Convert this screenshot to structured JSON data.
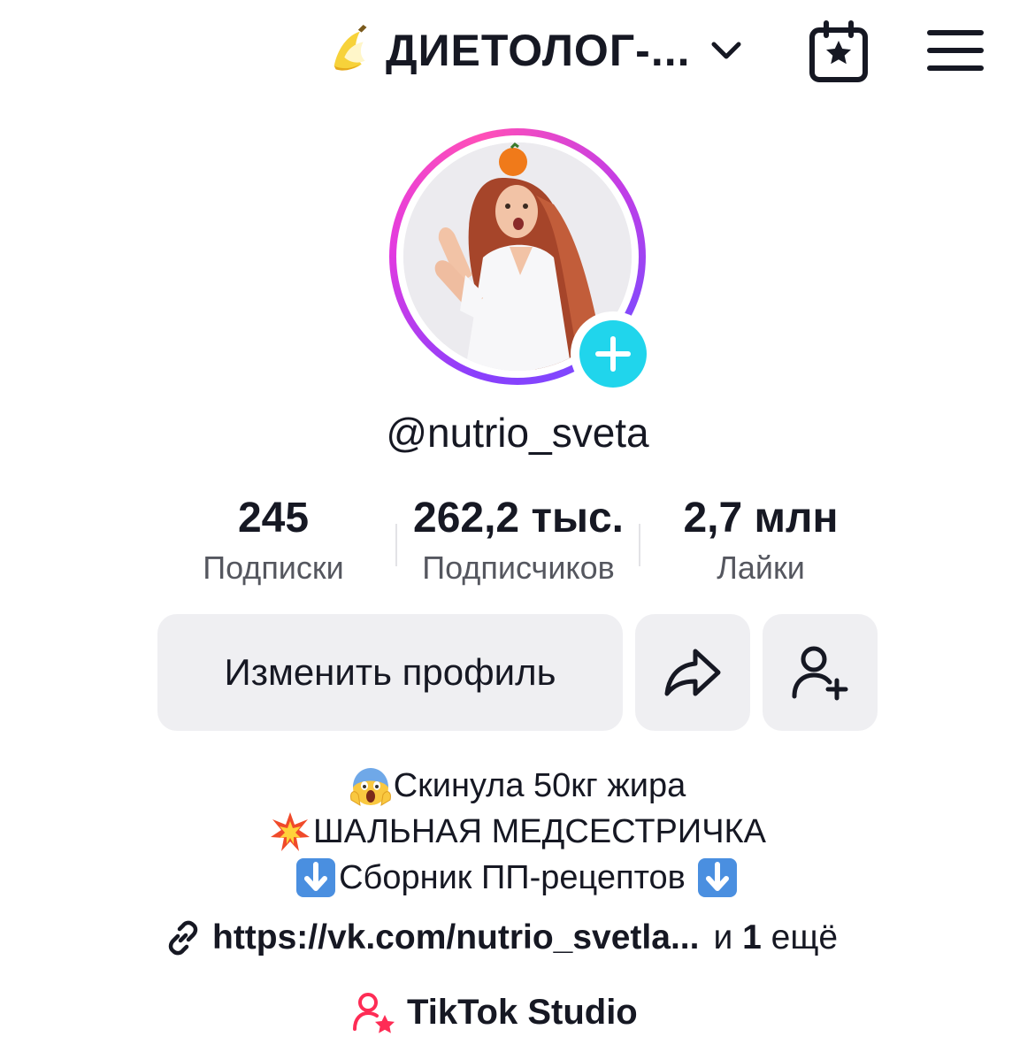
{
  "header": {
    "account_name": "ДИЕТОЛОГ-...",
    "account_emoji": "banana-emoji",
    "dropdown_icon": "chevron-down-icon",
    "calendar_icon": "calendar-star-icon",
    "menu_icon": "hamburger-menu-icon"
  },
  "profile": {
    "username": "@nutrio_sveta",
    "avatar_ring_colors": [
      "#8a3ffc",
      "#e23ae0",
      "#ff4fb8"
    ],
    "add_badge_color": "#20d5ec"
  },
  "stats": [
    {
      "value": "245",
      "label": "Подписки"
    },
    {
      "value": "262,2 тыс.",
      "label": "Подписчиков"
    },
    {
      "value": "2,7 млн",
      "label": "Лайки"
    }
  ],
  "actions": {
    "edit_profile_label": "Изменить профиль",
    "share_icon": "share-arrow-icon",
    "add_friend_icon": "add-user-icon"
  },
  "bio": {
    "line1": "Скинула 50кг жира",
    "line2": "ШАЛЬНАЯ МЕДСЕСТРИЧКА",
    "line3": "Сборник ПП-рецептов",
    "line1_emoji": "scream-emoji",
    "line2_emoji": "collision-emoji",
    "line3_emoji": "down-arrow-emoji"
  },
  "link": {
    "url_text": "https://vk.com/nutrio_svetla...",
    "more_prefix": "и",
    "more_count": "1",
    "more_suffix": "ещё"
  },
  "studio": {
    "label": "TikTok Studio",
    "icon_color": "#fe2c55"
  }
}
